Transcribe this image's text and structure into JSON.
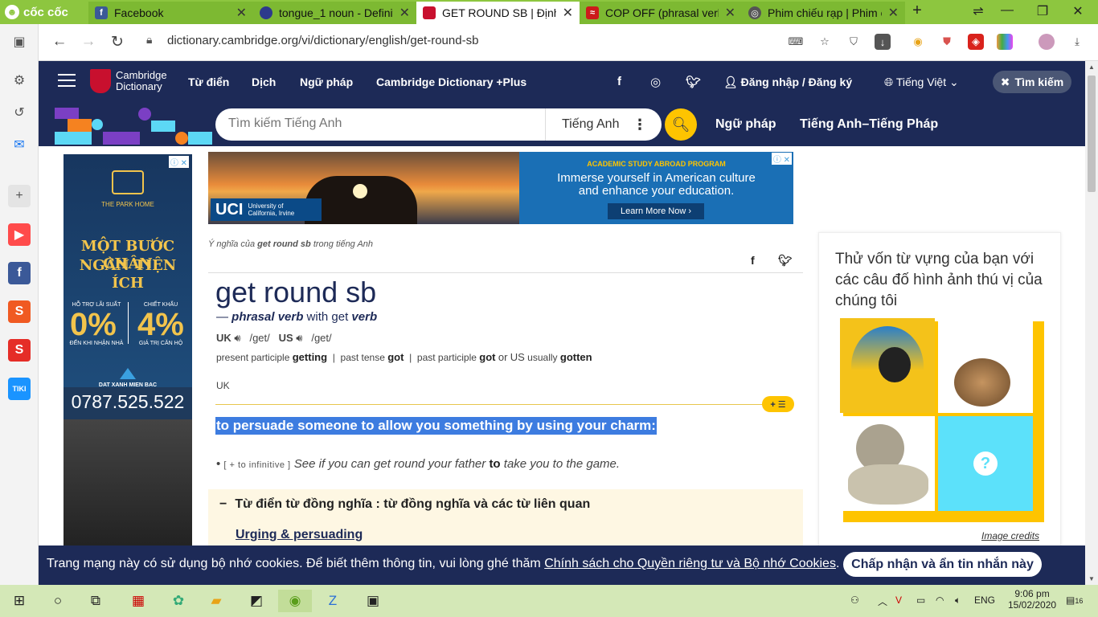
{
  "browser": {
    "name": "cốc cốc",
    "tabs": [
      {
        "title": "Facebook",
        "icon_letter": "f",
        "color": "#3b5998"
      },
      {
        "title": "tongue_1 noun - Definiti",
        "icon_letter": "o",
        "color": "#2d3a8c"
      },
      {
        "title": "GET ROUND SB | Định n",
        "icon_letter": "C",
        "color": "#c8102e",
        "active": true
      },
      {
        "title": "COP OFF (phrasal verb)",
        "icon_letter": "≈",
        "color": "#cc1b1b"
      },
      {
        "title": "Phim chiếu rạp | Phim c",
        "icon_letter": "◎",
        "color": "#555555"
      }
    ],
    "new_tab": "+",
    "url": "dictionary.cambridge.org/vi/dictionary/english/get-round-sb"
  },
  "header": {
    "brand_line1": "Cambridge",
    "brand_line2": "Dictionary",
    "nav": [
      "Từ điển",
      "Dịch",
      "Ngữ pháp",
      "Cambridge Dictionary +Plus"
    ],
    "login": "Đăng nhập / Đăng ký",
    "language": "Tiếng Việt",
    "close_search": "Tìm kiếm"
  },
  "search": {
    "placeholder": "Tìm kiếm Tiếng Anh",
    "dictionary": "Tiếng Anh",
    "link_grammar": "Ngữ pháp",
    "link_bilingual": "Tiếng Anh–Tiếng Pháp"
  },
  "left_ad": {
    "brand": "THE PARK HOME",
    "headline1": "MỘT BƯỚC CHÂN",
    "headline2": "NGÀN TIỆN ÍCH",
    "label1": "HỖ TRỢ LÃI SUẤT",
    "value1": "0%",
    "sub1": "ĐẾN KHI NHẬN NHÀ",
    "label2": "CHIẾT KHẤU",
    "value2": "4%",
    "sub2": "GIÁ TRỊ CĂN HỘ",
    "developer": "DAT XANH MIEN BAC",
    "phone": "0787.525.522"
  },
  "banner_ad": {
    "program": "ACADEMIC STUDY ABROAD PROGRAM",
    "line1": "Immerse yourself in American culture",
    "line2": "and enhance your education.",
    "cta": "Learn More Now",
    "logo": "UCI",
    "logo_sub1": "University of",
    "logo_sub2": "California, Irvine"
  },
  "entry": {
    "breadcrumb_pre": "Ý nghĩa của ",
    "breadcrumb_word": "get round sb",
    "breadcrumb_post": " trong tiếng Anh",
    "headword": "get round sb",
    "pos_dash": "— ",
    "pos": "phrasal verb",
    "pos_with": " with get ",
    "pos_verb": "verb",
    "uk_label": "UK",
    "uk_ipa": "/ɡet/",
    "us_label": "US",
    "us_ipa": "/ɡet/",
    "forms": {
      "present_participle_label": "present participle",
      "present_participle": "getting",
      "past_tense_label": "past tense",
      "past_tense": "got",
      "past_participle_label": "past participle",
      "past_participle": "got",
      "or_label": "or US",
      "usually_label": "usually",
      "past_participle_us": "gotten"
    },
    "region": "UK",
    "more_button": "+ ☰",
    "definition": "to persuade someone to allow you something by using your charm:",
    "grammar_tag": "[ + to infinitive ]",
    "example_pre": "See if you can get round your father ",
    "example_bold": "to",
    "example_post": " take you to the game.",
    "synonyms_title": "Từ điển từ đồng nghĩa : từ đồng nghĩa và các từ liên quan",
    "synonyms_link": "Urging & persuading"
  },
  "quiz": {
    "title": "Thử vốn từ vựng của bạn với các câu đố hình ảnh thú vị của chúng tôi",
    "credits": "Image credits"
  },
  "cookie": {
    "message": "Trang mạng này có sử dụng bộ nhớ cookies. Để biết thêm thông tin, vui lòng ghé thăm ",
    "link": "Chính sách cho Quyền riêng tư và Bộ nhớ Cookies",
    "message_end": ".",
    "accept": "Chấp nhận và ẩn tin nhắn này"
  },
  "taskbar": {
    "lang": "ENG",
    "time": "9:06 pm",
    "date": "15/02/2020",
    "notif_count": "16"
  }
}
